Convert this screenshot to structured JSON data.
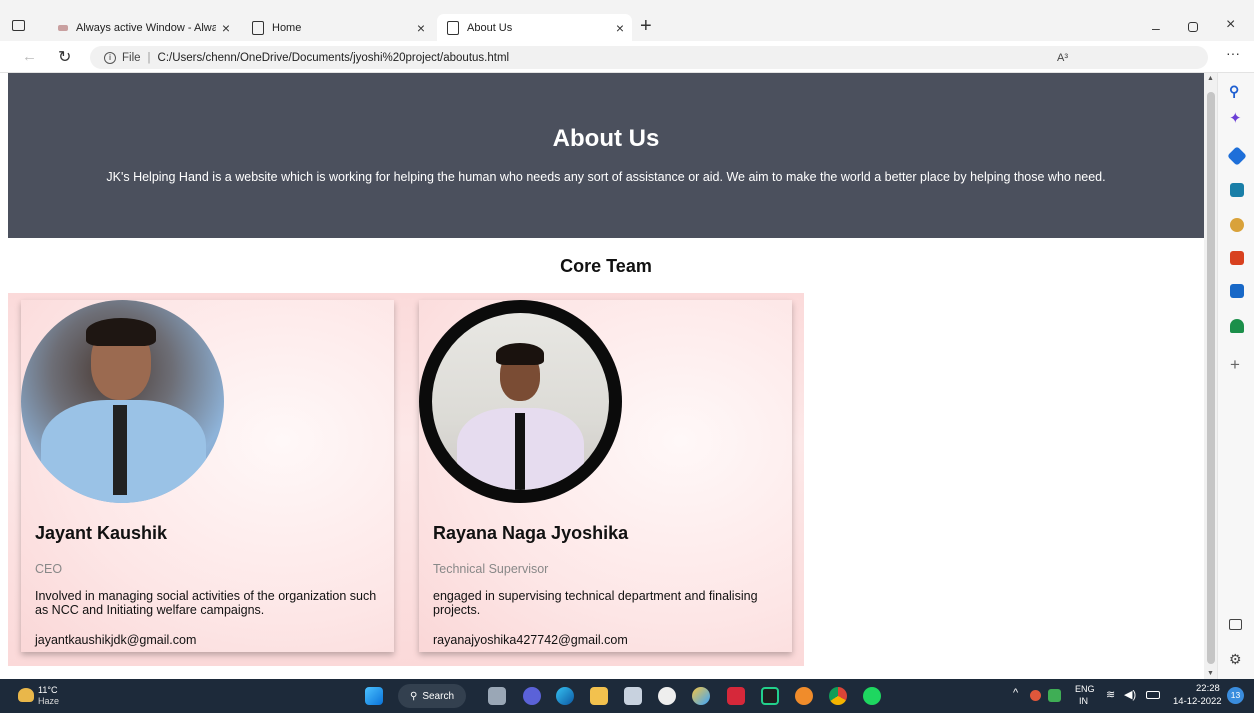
{
  "browser": {
    "tabs": [
      {
        "title": "Always active Window - Always ‧",
        "active": false
      },
      {
        "title": "Home",
        "active": false
      },
      {
        "title": "About Us",
        "active": true
      }
    ],
    "url_prefix": "File",
    "url": "C:/Users/chenn/OneDrive/Documents/jyoshi%20project/aboutus.html",
    "read_aloud": "A³"
  },
  "page": {
    "hero_title": "About Us",
    "hero_text": "JK's Helping Hand is a website which is working for helping the human who needs any sort of assistance or aid. We aim to make the world a better place by helping those who need.",
    "section_title": "Core Team",
    "members": [
      {
        "name": "Jayant Kaushik",
        "role": "CEO",
        "desc": "Involved in managing social activities of the organization such as NCC and Initiating welfare campaigns.",
        "email": "jayantkaushikjdk@gmail.com"
      },
      {
        "name": "Rayana Naga Jyoshika",
        "role": "Technical Supervisor",
        "desc": "engaged in supervising technical department and finalising projects.",
        "email": "rayanajyoshika427742@gmail.com"
      }
    ]
  },
  "taskbar": {
    "weather_temp": "11°C",
    "weather_desc": "Haze",
    "search_label": "Search",
    "lang_top": "ENG",
    "lang_bottom": "IN",
    "time": "22:28",
    "date": "14-12-2022",
    "notif_count": "13"
  },
  "colors": {
    "hero_bg": "#4b505d",
    "card_bg": "#fde6e6",
    "taskbar_bg": "#1d2a3a"
  }
}
